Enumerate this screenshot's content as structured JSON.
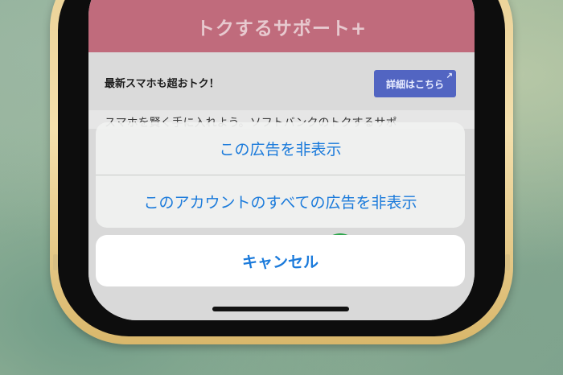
{
  "app": {
    "banner_title": "トクするサポート+",
    "promo_text": "最新スマホも超おトク！",
    "detail_button_label": "詳細はこちら",
    "body_text": "スマホを賢く手に入れよう。ソフトバンクのトクするサポ"
  },
  "action_sheet": {
    "hide_ad_label": "この広告を非表示",
    "hide_all_ads_label": "このアカウントのすべての広告を非表示",
    "cancel_label": "キャンセル"
  },
  "colors": {
    "action_text": "#1a7adb",
    "banner_bg": "#c06b7c",
    "detail_button_bg": "#5265c2",
    "phone_frame": "#e9cf93"
  }
}
